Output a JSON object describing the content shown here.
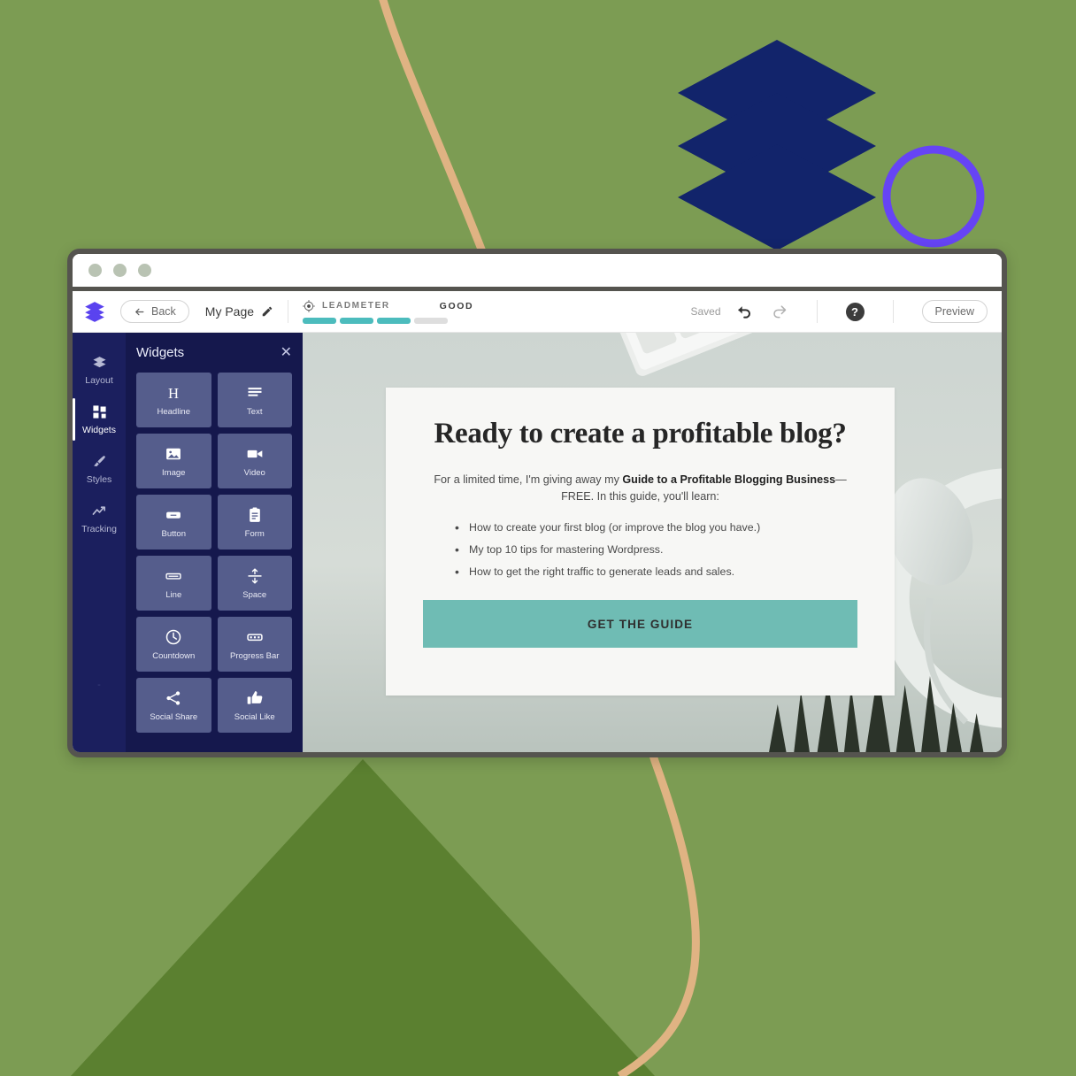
{
  "background": {
    "base_color": "#7c9c53",
    "triangle_color": "#5b8030",
    "curve_color": "#e0b383",
    "diamond_color": "#12246b",
    "circle_color": "#6644f5"
  },
  "browser": {
    "dots": [
      "window-dot-1",
      "window-dot-2",
      "window-dot-3"
    ],
    "frame_color": "#55544f"
  },
  "toolbar": {
    "logo_icon": "layers-logo-icon",
    "back_label": "Back",
    "back_icon": "arrow-left-icon",
    "page_name": "My Page",
    "edit_icon": "pencil-icon",
    "leadmeter": {
      "icon": "target-icon",
      "label": "LEADMETER",
      "grade": "GOOD",
      "segments_total": 4,
      "segments_filled": 3,
      "fill_color": "#4cbcbd",
      "empty_color": "#dedede"
    },
    "saved_label": "Saved",
    "undo_icon": "undo-arrow-icon",
    "redo_icon": "redo-arrow-icon",
    "help_label": "?",
    "preview_label": "Preview"
  },
  "rail": {
    "items": [
      {
        "label": "Layout",
        "icon": "layers-icon",
        "active": false
      },
      {
        "label": "Widgets",
        "icon": "grid-blocks-icon",
        "active": true
      },
      {
        "label": "Styles",
        "icon": "paintbrush-icon",
        "active": false
      },
      {
        "label": "Tracking",
        "icon": "trend-line-icon",
        "active": false
      }
    ],
    "footer_mark": "-"
  },
  "panel": {
    "title": "Widgets",
    "close_icon": "close-icon",
    "widgets": [
      {
        "label": "Headline",
        "icon": "heading-h-icon"
      },
      {
        "label": "Text",
        "icon": "text-lines-icon"
      },
      {
        "label": "Image",
        "icon": "image-icon"
      },
      {
        "label": "Video",
        "icon": "video-camera-icon"
      },
      {
        "label": "Button",
        "icon": "button-icon"
      },
      {
        "label": "Form",
        "icon": "clipboard-form-icon"
      },
      {
        "label": "Line",
        "icon": "horizontal-line-icon"
      },
      {
        "label": "Space",
        "icon": "vertical-spacer-icon"
      },
      {
        "label": "Countdown",
        "icon": "clock-icon"
      },
      {
        "label": "Progress Bar",
        "icon": "progress-bar-icon"
      },
      {
        "label": "Social Share",
        "icon": "share-icon"
      },
      {
        "label": "Social Like",
        "icon": "thumbs-up-icon"
      }
    ]
  },
  "landing_page": {
    "headline": "Ready to create a profitable blog?",
    "subhead_pre": "For a limited time, I'm giving away my ",
    "subhead_bold": "Guide to a Profitable Blogging Business",
    "subhead_post": "— FREE. In this guide, you'll learn:",
    "bullets": [
      "How to create your first blog (or improve the blog you have.)",
      "My top 10 tips for mastering Wordpress.",
      "How to get the right traffic to generate leads and sales."
    ],
    "cta_label": "GET THE GUIDE",
    "cta_color": "#6fbcb4"
  }
}
